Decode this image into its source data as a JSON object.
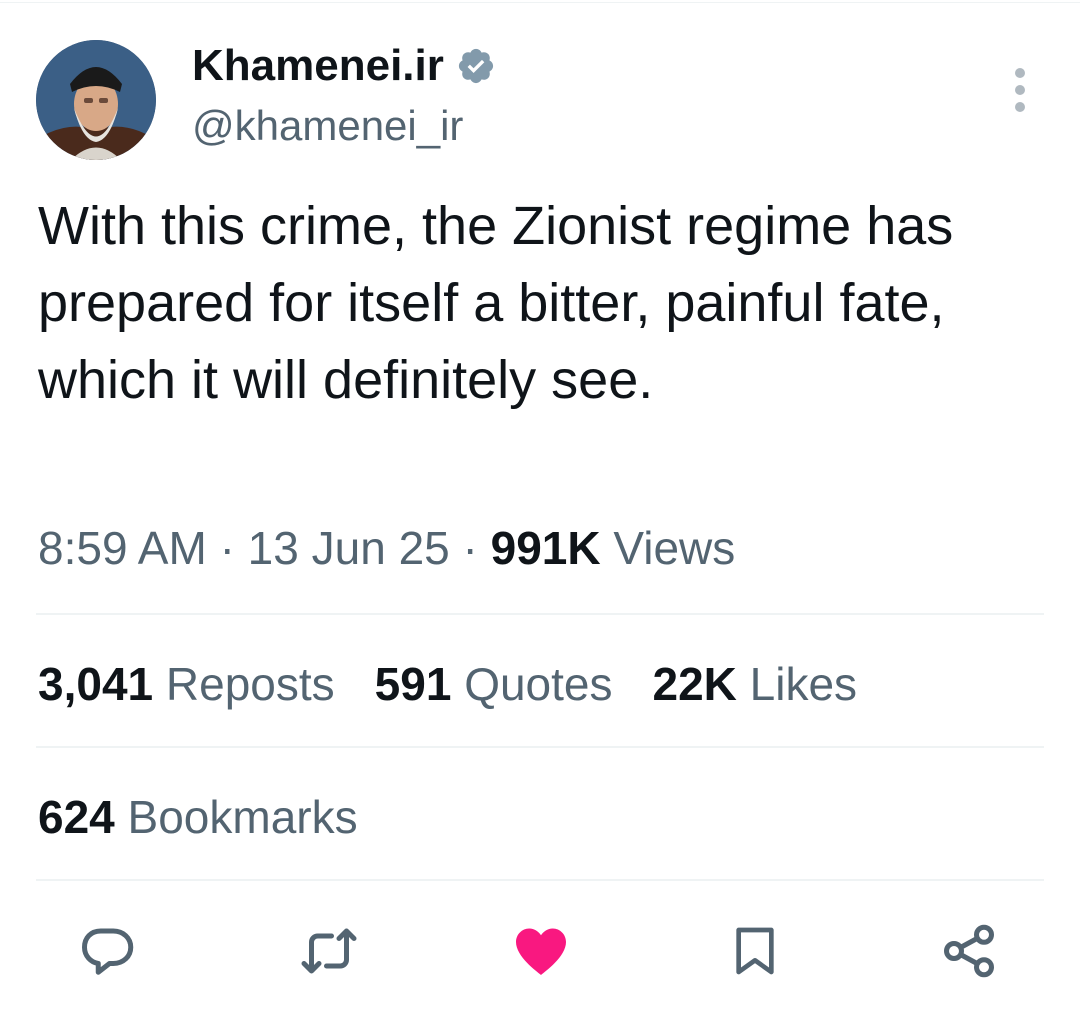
{
  "author": {
    "display_name": "Khamenei.ir",
    "handle": "@khamenei_ir",
    "verified_icon": "verified-badge-icon",
    "avatar": "profile-avatar"
  },
  "tweet": {
    "text": "With this crime, the Zionist regime has prepared for itself a bitter, painful fate, which it will definitely see.",
    "time": "8:59 AM",
    "separator": "·",
    "date": "13 Jun 25",
    "views_count": "991K",
    "views_label": "Views"
  },
  "stats": {
    "reposts_count": "3,041",
    "reposts_label": "Reposts",
    "quotes_count": "591",
    "quotes_label": "Quotes",
    "likes_count": "22K",
    "likes_label": "Likes",
    "bookmarks_count": "624",
    "bookmarks_label": "Bookmarks"
  },
  "actions": {
    "reply": "reply-icon",
    "repost": "repost-icon",
    "like": "heart-icon",
    "bookmark": "bookmark-icon",
    "share": "share-icon",
    "like_active": true
  },
  "colors": {
    "text_primary": "#0f1419",
    "text_secondary": "#536471",
    "like_active": "#f91880",
    "verified": "#829aab",
    "divider": "#eff3f4"
  }
}
